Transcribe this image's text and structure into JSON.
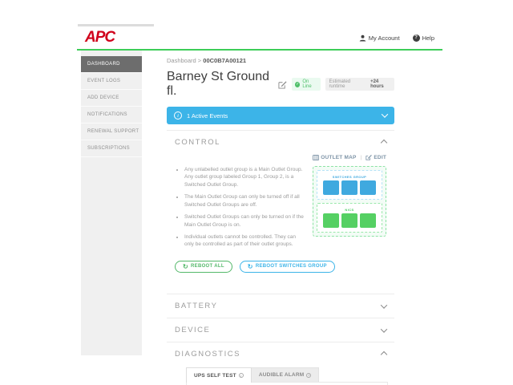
{
  "header": {
    "logo": "APC",
    "my_account": "My Account",
    "help": "Help",
    "help_glyph": "?"
  },
  "sidebar": {
    "items": [
      {
        "label": "DASHBOARD",
        "active": true
      },
      {
        "label": "EVENT LOGS",
        "active": false
      },
      {
        "label": "ADD DEVICE",
        "active": false
      },
      {
        "label": "NOTIFICATIONS",
        "active": false
      },
      {
        "label": "RENEWAL SUPPORT",
        "active": false
      },
      {
        "label": "SUBSCRIPTIONS",
        "active": false
      }
    ]
  },
  "breadcrumb": {
    "root": "Dashboard",
    "separator": ">",
    "current": "00C0B7A00121"
  },
  "device": {
    "title": "Barney St Ground fl.",
    "status": "On Line",
    "runtime_label": "Estimated runtime",
    "runtime_value": "+24 hours"
  },
  "alert": {
    "text": "1 Active Events",
    "info_glyph": "i"
  },
  "control": {
    "title": "CONTROL",
    "outlet_map_link": "OUTLET MAP",
    "link_separator": "|",
    "edit_link": "EDIT",
    "bullets": [
      "Any unlabelled outlet group is a Main Outlet Group. Any outlet group labeled Group 1, Group 2, is a Switched Outlet Group.",
      "The Main Outlet Group can only be turned off if all Switched Outlet Groups are off.",
      "Switched Outlet Groups can only be turned on if the Main Outlet Group is on.",
      "Individual outlets cannot be controlled. They can only be controlled as part of their outlet groups."
    ],
    "outlet_groups": [
      {
        "label": "SWITCHES GROUP",
        "label_color": "#3fa9df",
        "border_color": "#b5e3f7",
        "square_color": "#3fa9df",
        "outlets": 3
      },
      {
        "label": "NICS",
        "label_color": "#4ccc63",
        "border_color": "#9ae8ab",
        "square_color": "#55d063",
        "outlets": 3
      }
    ],
    "buttons": [
      {
        "label": "REBOOT ALL",
        "style": "green",
        "icon": "↻"
      },
      {
        "label": "REBOOT SWITCHES GROUP",
        "style": "blue",
        "icon": "↻"
      }
    ]
  },
  "battery": {
    "title": "BATTERY"
  },
  "device_section": {
    "title": "DEVICE"
  },
  "diagnostics": {
    "title": "DIAGNOSTICS",
    "tabs": [
      {
        "label": "UPS SELF TEST",
        "active": true
      },
      {
        "label": "AUDIBLE ALARM",
        "active": false
      }
    ]
  },
  "colors": {
    "brand_red": "#d0011b",
    "brand_green": "#3dcd58",
    "alert_blue": "#3cb4e8",
    "online_green": "#4fc06a",
    "sidebar_active": "#6d6d6d"
  }
}
